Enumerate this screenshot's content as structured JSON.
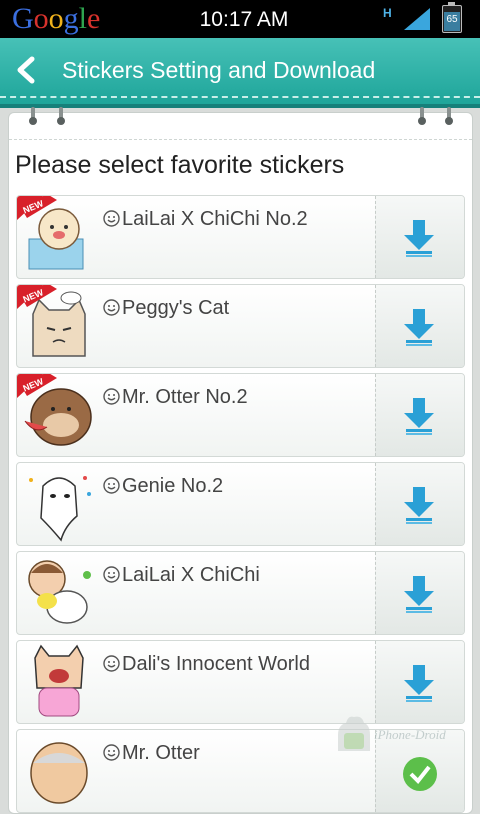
{
  "status_bar": {
    "brand": "Google",
    "time": "10:17 AM",
    "network": "H",
    "battery": "65"
  },
  "header": {
    "title": "Stickers Setting and Download"
  },
  "prompt": "Please select favorite stickers",
  "stickers": [
    {
      "name": "LaiLai X ChiChi No.2",
      "new": true,
      "badge": "NEW"
    },
    {
      "name": "Peggy's Cat",
      "new": true,
      "badge": "NEW"
    },
    {
      "name": "Mr. Otter No.2",
      "new": true,
      "badge": "NEW"
    },
    {
      "name": "Genie No.2",
      "new": false
    },
    {
      "name": "LaiLai X ChiChi",
      "new": false
    },
    {
      "name": "Dali's Innocent World",
      "new": false
    },
    {
      "name": "Mr. Otter",
      "new": false
    }
  ],
  "watermark": "iPhone-Droid",
  "colors": {
    "header_teal": "#1ea59a",
    "download_blue": "#2aa0d6",
    "new_red": "#d8202a"
  }
}
